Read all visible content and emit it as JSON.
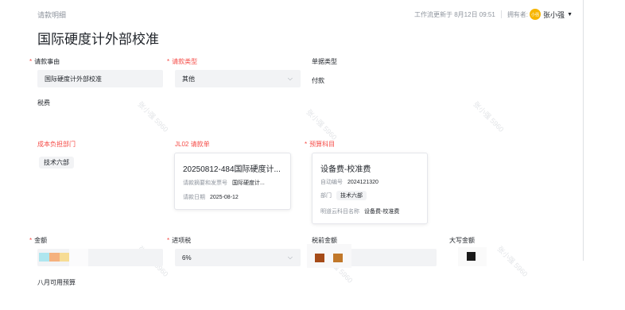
{
  "header": {
    "breadcrumb": "请款明细",
    "title": "国际硬度计外部校准",
    "updated_text": "工作流更新于 8月12日 09:51",
    "owner_label": "拥有者:",
    "owner_avatar": "小强",
    "owner_name": "张小强"
  },
  "fields": {
    "reason": {
      "label": "请款事由",
      "value": "国际硬度计外部校准",
      "required": true
    },
    "type": {
      "label": "请款类型",
      "value": "其他",
      "required": true
    },
    "doc_type": {
      "label": "单据类型",
      "value": "付款"
    },
    "tax": {
      "label": "税费",
      "value": ""
    },
    "cost_dept": {
      "label": "成本负担部门",
      "value": "技术六部"
    },
    "jl02": {
      "label": "JL02 请款单",
      "card": {
        "title": "20250812-484国际硬度计...",
        "summary_label": "请款摘要和发票号",
        "summary_value": "国际硬度计...",
        "date_label": "请款日期",
        "date_value": "2025-08-12"
      }
    },
    "budget": {
      "label": "预算科目",
      "required": true,
      "card": {
        "title": "设备费-校准费",
        "id_label": "自动编号",
        "id_value": "2024121320",
        "dept_label": "部门",
        "dept_value": "技术六部",
        "subject_label": "明道云科目名称",
        "subject_value": "设备费-校准费"
      }
    },
    "amount": {
      "label": "金额",
      "required": true
    },
    "input_tax": {
      "label": "进项税",
      "value": "6%",
      "required": true
    },
    "pretax": {
      "label": "税前金额"
    },
    "capital": {
      "label": "大写金额"
    },
    "august_budget": {
      "label": "八月可用预算"
    }
  },
  "watermark_text": "张小强 5960",
  "colors": {
    "required": "#f54a45",
    "avatar": "#f7b500",
    "field_bg": "#f2f3f5"
  }
}
